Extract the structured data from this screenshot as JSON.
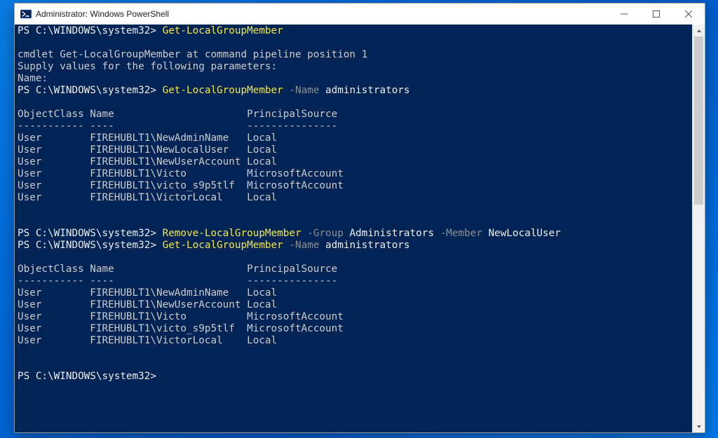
{
  "window": {
    "title": "Administrator: Windows PowerShell"
  },
  "colors": {
    "terminal_bg": "#012456",
    "text_default": "#cccccc",
    "text_white": "#eeeeee",
    "text_yellow": "#f6e84a",
    "text_gray": "#8e8e8e"
  },
  "icons": {
    "app": "powershell-icon",
    "minimize": "minimize-icon",
    "maximize": "maximize-icon",
    "close": "close-icon",
    "scroll_up": "chevron-up-icon",
    "scroll_down": "chevron-down-icon"
  },
  "session": {
    "prompt": "PS C:\\WINDOWS\\system32>",
    "lines": {
      "l01_cmd": "Get-LocalGroupMember",
      "l02_blank": "",
      "l03": "cmdlet Get-LocalGroupMember at command pipeline position 1",
      "l04": "Supply values for the following parameters:",
      "l05": "Name:",
      "l06_cmd": "Get-LocalGroupMember",
      "l06_param": " -Name ",
      "l06_arg": "administrators",
      "l07_blank": "",
      "hdr_obj": "ObjectClass",
      "hdr_name": "Name",
      "hdr_src": "PrincipalSource",
      "rule_obj": "-----------",
      "rule_name": "----",
      "rule_src": "---------------",
      "t1": [
        {
          "obj": "User",
          "name": "FIREHUBLT1\\NewAdminName",
          "src": "Local"
        },
        {
          "obj": "User",
          "name": "FIREHUBLT1\\NewLocalUser",
          "src": "Local"
        },
        {
          "obj": "User",
          "name": "FIREHUBLT1\\NewUserAccount",
          "src": "Local"
        },
        {
          "obj": "User",
          "name": "FIREHUBLT1\\Victo",
          "src": "MicrosoftAccount"
        },
        {
          "obj": "User",
          "name": "FIREHUBLT1\\victo_s9p5tlf",
          "src": "MicrosoftAccount"
        },
        {
          "obj": "User",
          "name": "FIREHUBLT1\\VictorLocal",
          "src": "Local"
        }
      ],
      "l20_blank": "",
      "l21_blank": "",
      "l22_cmd": "Remove-LocalGroupMember",
      "l22_p1": " -Group ",
      "l22_a1": "Administrators",
      "l22_p2": " -Member ",
      "l22_a2": "NewLocalUser",
      "l23_cmd": "Get-LocalGroupMember",
      "l23_param": " -Name ",
      "l23_arg": "administrators",
      "l24_blank": "",
      "t2": [
        {
          "obj": "User",
          "name": "FIREHUBLT1\\NewAdminName",
          "src": "Local"
        },
        {
          "obj": "User",
          "name": "FIREHUBLT1\\NewUserAccount",
          "src": "Local"
        },
        {
          "obj": "User",
          "name": "FIREHUBLT1\\Victo",
          "src": "MicrosoftAccount"
        },
        {
          "obj": "User",
          "name": "FIREHUBLT1\\victo_s9p5tlf",
          "src": "MicrosoftAccount"
        },
        {
          "obj": "User",
          "name": "FIREHUBLT1\\VictorLocal",
          "src": "Local"
        }
      ],
      "l35_blank": "",
      "l36_blank": ""
    },
    "columns": {
      "obj_width": 12,
      "name_width": 26
    }
  }
}
